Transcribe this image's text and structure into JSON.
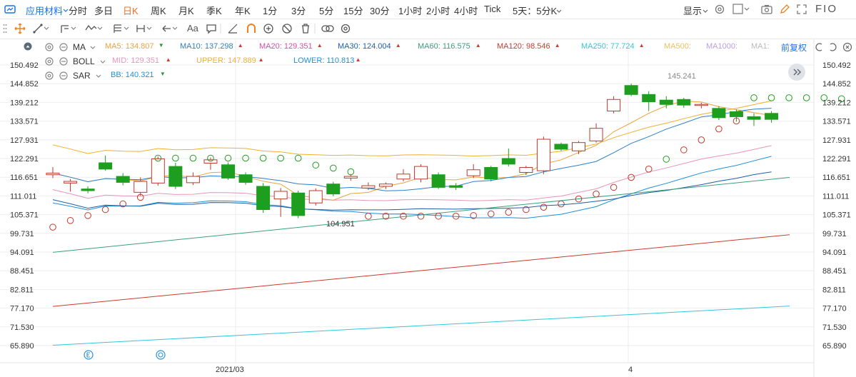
{
  "topbar": {
    "name": "应用材料",
    "periods": [
      "分时",
      "多日",
      "日K",
      "周K",
      "月K",
      "季K",
      "年K",
      "1分",
      "3分",
      "5分",
      "15分",
      "30分",
      "1小时",
      "2小时",
      "4小时",
      "Tick"
    ],
    "active_period": "日K",
    "multi": "5天：5分K",
    "display": "显示",
    "fq": "FIO"
  },
  "toolbar": {
    "text_tool": "Aa"
  },
  "indicators": {
    "ma": {
      "label": "MA",
      "items": [
        {
          "name": "MA5",
          "value": "134.807",
          "color": "#e8a33d",
          "arrow": "down"
        },
        {
          "name": "MA10",
          "value": "137.298",
          "color": "#2f7fc8",
          "arrow": "up"
        },
        {
          "name": "MA20",
          "value": "129.351",
          "color": "#d64fa8",
          "arrow": "up"
        },
        {
          "name": "MA30",
          "value": "124.004",
          "color": "#1f5fa8",
          "arrow": "up"
        },
        {
          "name": "MA60",
          "value": "116.575",
          "color": "#3aa07a",
          "arrow": "up"
        },
        {
          "name": "MA120",
          "value": "98.546",
          "color": "#cc3a2e",
          "arrow": "up"
        },
        {
          "name": "MA250",
          "value": "77.724",
          "color": "#33c8d8",
          "arrow": "up"
        },
        {
          "name": "MA500",
          "value": "",
          "color": "#f0c060",
          "arrow": ""
        },
        {
          "name": "MA1000",
          "value": "",
          "color": "#b9a0e0",
          "arrow": ""
        },
        {
          "name": "MA1",
          "value": "",
          "color": "#bbbbbb",
          "arrow": ""
        }
      ],
      "fq_label": "前复权"
    },
    "boll": {
      "label": "BOLL",
      "items": [
        {
          "name": "MID",
          "value": "129.351",
          "color": "#e895b8",
          "arrow": "up"
        },
        {
          "name": "UPPER",
          "value": "147.889",
          "color": "#f0b030",
          "arrow": "up"
        },
        {
          "name": "LOWER",
          "value": "110.813",
          "color": "#1f8fd8",
          "arrow": "up"
        }
      ]
    },
    "sar": {
      "label": "SAR",
      "items": [
        {
          "name": "BB",
          "value": "140.321",
          "color": "#1f8fd8",
          "arrow": "down"
        }
      ]
    }
  },
  "chart_data": {
    "type": "candlestick",
    "yticks": [
      "150.492",
      "144.852",
      "139.212",
      "133.571",
      "127.931",
      "122.291",
      "116.651",
      "111.011",
      "105.371",
      "99.731",
      "94.091",
      "88.451",
      "82.811",
      "77.170",
      "71.530",
      "65.890"
    ],
    "xlabels": [
      "2021/03",
      "4"
    ],
    "annotations": {
      "high": "145.241",
      "low": "104.951"
    },
    "candles": [
      {
        "o": 117.4,
        "c": 117.9,
        "h": 119.7,
        "l": 116.4
      },
      {
        "o": 114.9,
        "c": 115.4,
        "h": 116.1,
        "l": 112.3
      },
      {
        "o": 113.1,
        "c": 112.6,
        "h": 113.9,
        "l": 111.8
      },
      {
        "o": 121.0,
        "c": 119.1,
        "h": 123.2,
        "l": 118.6
      },
      {
        "o": 116.9,
        "c": 115.1,
        "h": 117.9,
        "l": 114.2
      },
      {
        "o": 112.1,
        "c": 115.4,
        "h": 116.6,
        "l": 111.1
      },
      {
        "o": 114.9,
        "c": 122.2,
        "h": 122.9,
        "l": 114.1
      },
      {
        "o": 119.9,
        "c": 113.9,
        "h": 121.0,
        "l": 113.1
      },
      {
        "o": 115.0,
        "c": 116.9,
        "h": 118.1,
        "l": 114.3
      },
      {
        "o": 120.9,
        "c": 121.9,
        "h": 122.6,
        "l": 118.9
      },
      {
        "o": 120.4,
        "c": 116.4,
        "h": 121.1,
        "l": 115.9
      },
      {
        "o": 117.4,
        "c": 115.1,
        "h": 118.1,
        "l": 114.4
      },
      {
        "o": 113.9,
        "c": 106.9,
        "h": 114.9,
        "l": 105.9
      },
      {
        "o": 110.1,
        "c": 112.4,
        "h": 113.4,
        "l": 104.7
      },
      {
        "o": 111.9,
        "c": 105.1,
        "h": 112.6,
        "l": 104.3
      },
      {
        "o": 108.9,
        "c": 112.6,
        "h": 113.3,
        "l": 108.1
      },
      {
        "o": 114.6,
        "c": 111.6,
        "h": 115.3,
        "l": 110.9
      },
      {
        "o": 116.4,
        "c": 116.9,
        "h": 117.6,
        "l": 115.6
      },
      {
        "o": 113.4,
        "c": 114.1,
        "h": 115.1,
        "l": 112.8
      },
      {
        "o": 113.9,
        "c": 114.6,
        "h": 115.1,
        "l": 113.1
      },
      {
        "o": 116.1,
        "c": 117.6,
        "h": 119.1,
        "l": 115.4
      },
      {
        "o": 116.1,
        "c": 119.9,
        "h": 120.6,
        "l": 115.1
      },
      {
        "o": 117.4,
        "c": 113.6,
        "h": 118.1,
        "l": 113.1
      },
      {
        "o": 114.1,
        "c": 113.6,
        "h": 114.9,
        "l": 112.8
      },
      {
        "o": 117.1,
        "c": 118.9,
        "h": 120.6,
        "l": 116.4
      },
      {
        "o": 119.6,
        "c": 116.1,
        "h": 120.1,
        "l": 115.4
      },
      {
        "o": 122.3,
        "c": 120.6,
        "h": 125.3,
        "l": 119.9
      },
      {
        "o": 118.1,
        "c": 119.6,
        "h": 120.1,
        "l": 117.3
      },
      {
        "o": 118.6,
        "c": 128.1,
        "h": 128.9,
        "l": 117.6
      },
      {
        "o": 126.6,
        "c": 125.1,
        "h": 127.1,
        "l": 124.6
      },
      {
        "o": 124.6,
        "c": 127.1,
        "h": 127.6,
        "l": 123.6
      },
      {
        "o": 127.6,
        "c": 131.4,
        "h": 132.9,
        "l": 127.1
      },
      {
        "o": 136.6,
        "c": 140.1,
        "h": 141.1,
        "l": 135.9
      },
      {
        "o": 144.3,
        "c": 141.6,
        "h": 144.9,
        "l": 141.1
      },
      {
        "o": 141.6,
        "c": 139.4,
        "h": 142.6,
        "l": 136.6
      },
      {
        "o": 139.9,
        "c": 138.6,
        "h": 141.1,
        "l": 137.4
      },
      {
        "o": 140.1,
        "c": 138.4,
        "h": 140.6,
        "l": 137.6
      },
      {
        "o": 138.4,
        "c": 138.6,
        "h": 139.1,
        "l": 137.4
      },
      {
        "o": 137.4,
        "c": 134.6,
        "h": 138.1,
        "l": 133.9
      },
      {
        "o": 136.4,
        "c": 134.9,
        "h": 137.1,
        "l": 133.4
      },
      {
        "o": 134.9,
        "c": 134.1,
        "h": 135.9,
        "l": 132.1
      },
      {
        "o": 135.9,
        "c": 134.1,
        "h": 136.6,
        "l": 133.1
      }
    ],
    "sar": [
      101.6,
      103.6,
      105.1,
      106.9,
      108.6,
      110.6,
      122.4,
      122.4,
      122.4,
      122.4,
      122.4,
      122.4,
      122.4,
      122.4,
      122.4,
      120.3,
      119.4,
      118.3,
      104.9,
      104.9,
      104.9,
      104.9,
      104.9,
      104.9,
      105.1,
      105.6,
      106.1,
      106.9,
      107.6,
      108.6,
      110.1,
      111.6,
      113.6,
      116.6,
      119.1,
      122.1,
      124.9,
      127.9,
      131.2,
      133.6,
      140.6,
      140.6,
      140.6,
      140.6,
      140.6,
      140.3
    ]
  }
}
